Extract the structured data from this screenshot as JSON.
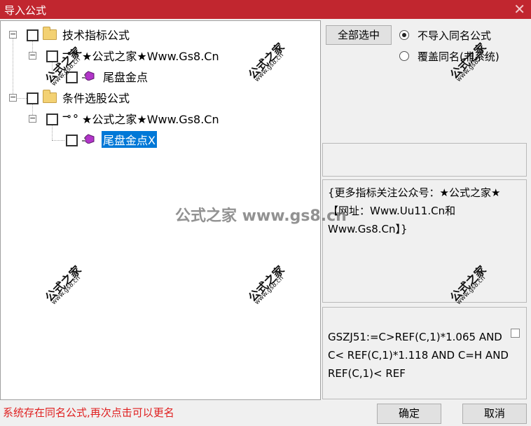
{
  "window": {
    "title": "导入公式",
    "close_glyph": "✕"
  },
  "tree": {
    "nodes": [
      {
        "label": "技术指标公式",
        "icon": "folder-icon",
        "expander": "−"
      },
      {
        "label": "★公式之家★Www.Gs8.Cn",
        "icon": "key-icon",
        "expander": "−"
      },
      {
        "label": "尾盘金点",
        "icon": "gem-icon"
      },
      {
        "label": "条件选股公式",
        "icon": "folder-icon",
        "expander": "−"
      },
      {
        "label": "★公式之家★Www.Gs8.Cn",
        "icon": "key-icon",
        "expander": "−"
      },
      {
        "label": "尾盘金点X",
        "icon": "gem-icon",
        "selected": true
      }
    ],
    "key_glyph": "⊸⚬"
  },
  "controls": {
    "select_all_label": "全部选中",
    "radio_options": [
      {
        "label": "不导入同名公式",
        "checked": true
      },
      {
        "label": "覆盖同名(非系统)",
        "checked": false
      }
    ]
  },
  "description": {
    "text": "{更多指标关注公众号：★公式之家★ 【网址：Www.Uu11.Cn和Www.Gs8.Cn】}"
  },
  "formula": {
    "text": "GSZJ51:=C>REF(C,1)*1.065 AND C< REF(C,1)*1.118 AND C=H AND REF(C,1)< REF"
  },
  "status_message": "系统存在同名公式,再次点击可以更名",
  "footer": {
    "ok_label": "确定",
    "cancel_label": "取消"
  },
  "watermark": {
    "cn": "公式之家",
    "en": "www.gs8.cn",
    "center": "公式之家 www.gs8.cn"
  },
  "colors": {
    "titlebar": "#c1262f",
    "selection": "#0078d7",
    "status_text": "#e02020"
  }
}
